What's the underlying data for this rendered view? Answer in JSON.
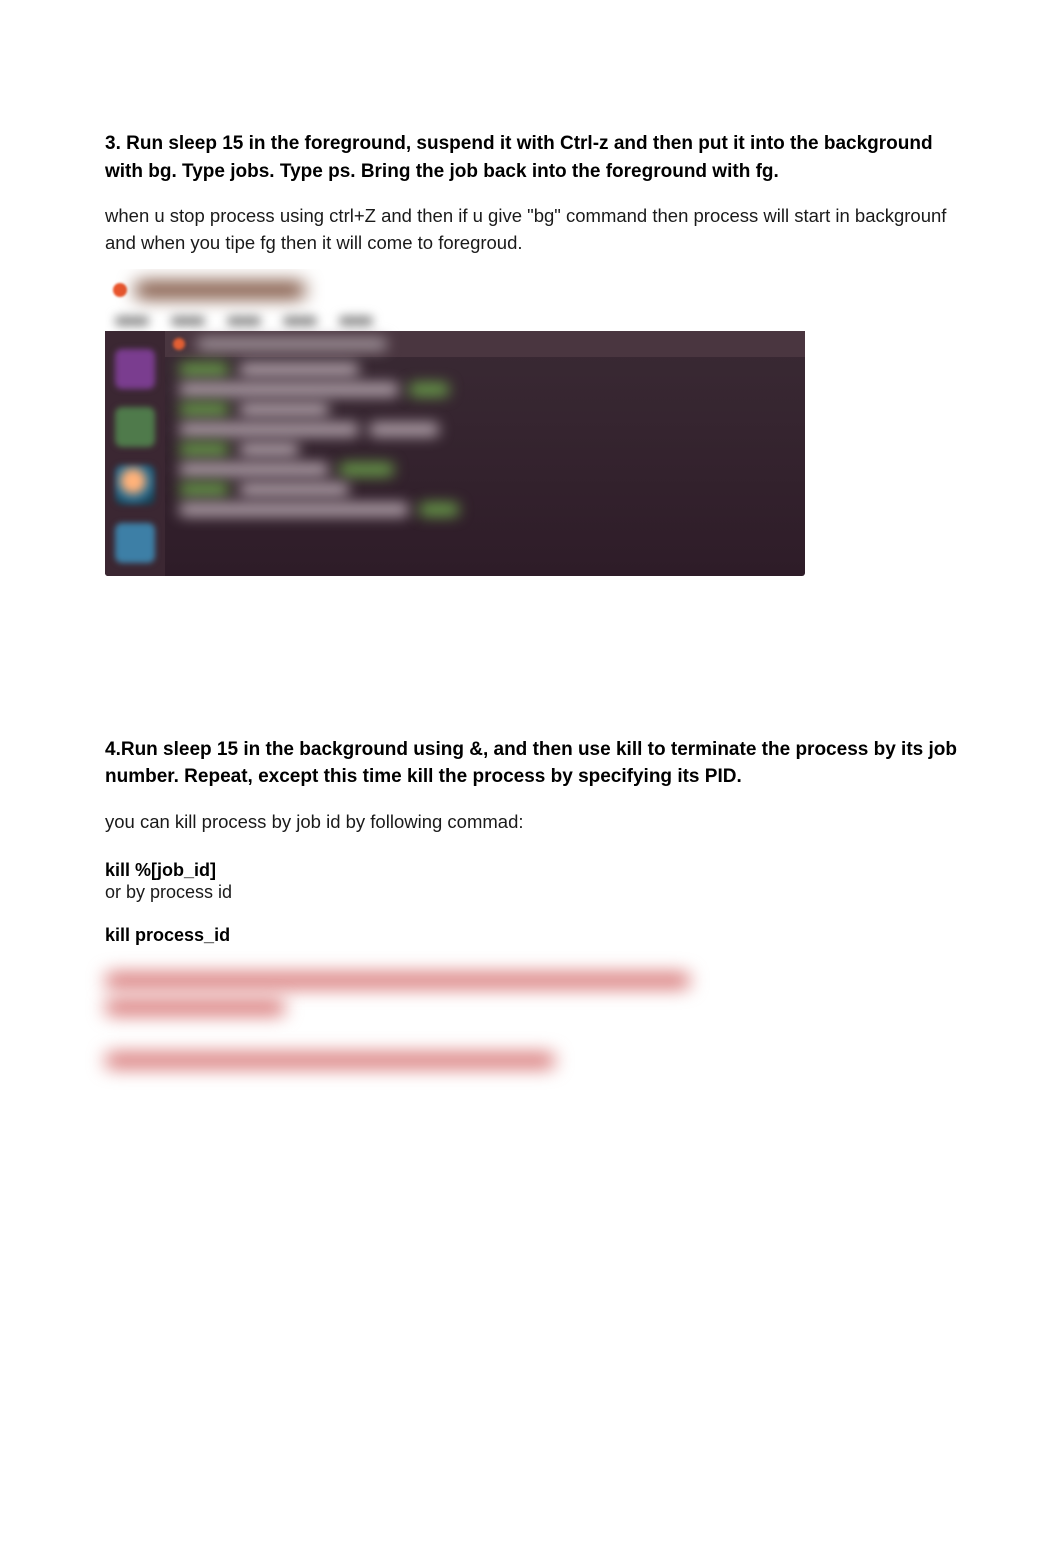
{
  "q3": {
    "heading": "3. Run sleep 15 in the foreground, suspend it with Ctrl-z and then put it into the background with bg. Type jobs. Type ps. Bring the job back into the foreground with fg.",
    "body": " when u stop process using ctrl+Z and then if u give \"bg\" command then process will start in backgrounf and when you tipe fg then it will come to foregroud."
  },
  "q4": {
    "heading_pre": "4.Run sleep 15 in the background using &, and then use kill to terminate the process by its job number. Repeat, except this ",
    "heading_time": "time ",
    "heading_post": "kill the process by specifying its PID.",
    "body1": "you can kill process by job id by following commad:",
    "kill_by_job": "kill %[job_id]",
    "or_by_pid": "or by process id",
    "kill_by_pid": "kill process_id"
  },
  "icons": {
    "ubuntu_dot": "ubuntu-logo",
    "term_dot": "window-close",
    "launcher": [
      "files-icon",
      "terminal-icon",
      "firefox-icon",
      "settings-icon"
    ]
  }
}
